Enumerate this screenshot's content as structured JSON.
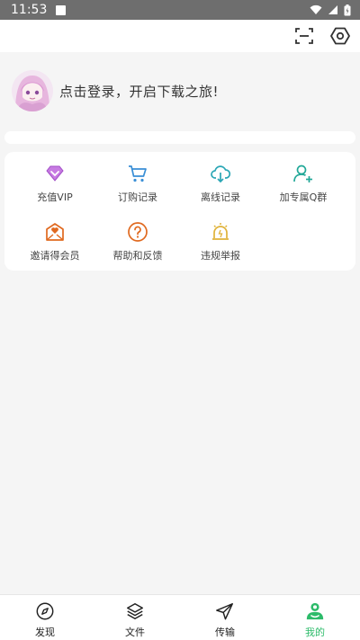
{
  "status_bar": {
    "time": "11:53"
  },
  "profile": {
    "login_prompt": "点击登录，开启下载之旅!"
  },
  "menu": {
    "items": [
      {
        "label": "充值VIP",
        "icon": "diamond-icon"
      },
      {
        "label": "订购记录",
        "icon": "cart-icon"
      },
      {
        "label": "离线记录",
        "icon": "cloud-download-icon"
      },
      {
        "label": "加专属Q群",
        "icon": "add-user-icon"
      },
      {
        "label": "邀请得会员",
        "icon": "envelope-heart-icon"
      },
      {
        "label": "帮助和反馈",
        "icon": "help-icon"
      },
      {
        "label": "违规举报",
        "icon": "alarm-icon"
      }
    ]
  },
  "bottom_nav": {
    "items": [
      {
        "label": "发现",
        "icon": "compass-icon"
      },
      {
        "label": "文件",
        "icon": "layers-icon"
      },
      {
        "label": "传输",
        "icon": "send-icon"
      },
      {
        "label": "我的",
        "icon": "me-icon"
      }
    ],
    "active_index": 3
  },
  "colors": {
    "accent": "#2dbb6a",
    "status_bar": "#6e6e6e",
    "vip": "#b65ad8",
    "cart": "#3a8fd6",
    "cloud": "#2aa6b5",
    "user": "#22a898",
    "invite": "#e0691f",
    "help": "#e0691f",
    "report": "#e0b33a"
  }
}
